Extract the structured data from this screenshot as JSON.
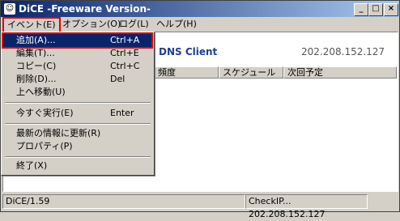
{
  "window": {
    "title": "DiCE -Freeware Version-",
    "controls": {
      "minimize": "_",
      "maximize": "□",
      "close": "×"
    }
  },
  "menubar": [
    "イベント(E)",
    "オプション(O)",
    "ログ(L)",
    "ヘルプ(H)"
  ],
  "header": {
    "server_name": "DNS Client",
    "ip": "202.208.152.127"
  },
  "columns": [
    "頻度",
    "スケジュール",
    "次回予定"
  ],
  "dropdown": {
    "items": [
      {
        "label": "追加(A)...",
        "shortcut": "Ctrl+A"
      },
      {
        "label": "編集(T)...",
        "shortcut": "Ctrl+E"
      },
      {
        "label": "コピー(C)",
        "shortcut": "Ctrl+C"
      },
      {
        "label": "削除(D)...",
        "shortcut": "Del"
      },
      {
        "label": "上へ移動(U)",
        "shortcut": ""
      },
      {
        "label": "今すぐ実行(E)",
        "shortcut": "Enter"
      },
      {
        "label": "最新の情報に更新(R)",
        "shortcut": ""
      },
      {
        "label": "プロパティ(P)",
        "shortcut": ""
      },
      {
        "label": "終了(X)",
        "shortcut": ""
      }
    ]
  },
  "statusbar": {
    "left": "DiCE/1.59",
    "right": "CheckIP... 202.208.152.127"
  },
  "colors": {
    "title_start": "#0a246a",
    "highlight_red": "#e00000",
    "selected": "#0a246a"
  }
}
